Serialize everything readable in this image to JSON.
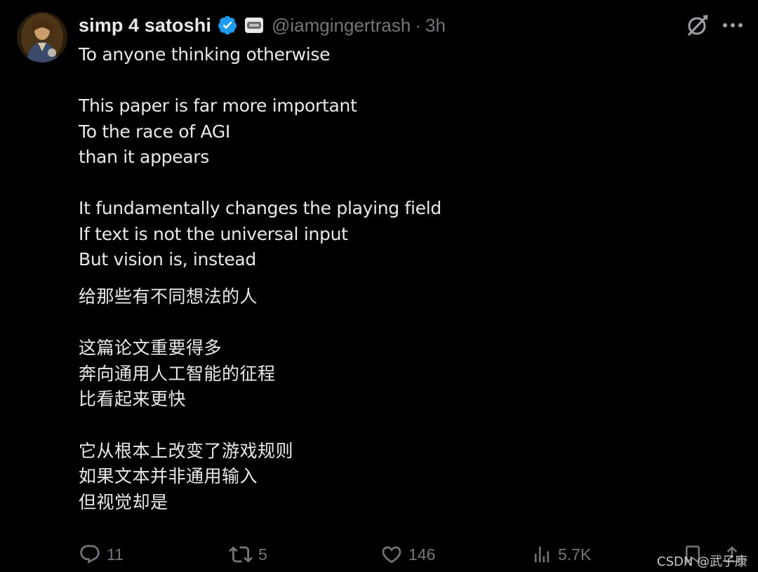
{
  "tweet": {
    "display_name": "simp 4 satoshi",
    "handle": "@iamgingertrash",
    "separator": "·",
    "time": "3h",
    "avatar_icon": "avatar-image",
    "verified_color": "#1d9bf0",
    "english_lines": [
      "To anyone thinking otherwise",
      "",
      "This paper is far more important",
      "To the race of AGI",
      "than it appears",
      "",
      "It fundamentally changes the playing field",
      "If text is not the universal input",
      "But vision is, instead"
    ],
    "chinese_lines": [
      "给那些有不同想法的人",
      "",
      "这篇论文重要得多",
      "奔向通用人工智能的征程",
      "比看起来更快",
      "",
      "它从根本上改变了游戏规则",
      "如果文本并非通用输入",
      "但视觉却是"
    ]
  },
  "actions": {
    "reply_count": "11",
    "retweet_count": "5",
    "like_count": "146",
    "views_count": "5.7K"
  },
  "watermark": "CSDN @武子康"
}
